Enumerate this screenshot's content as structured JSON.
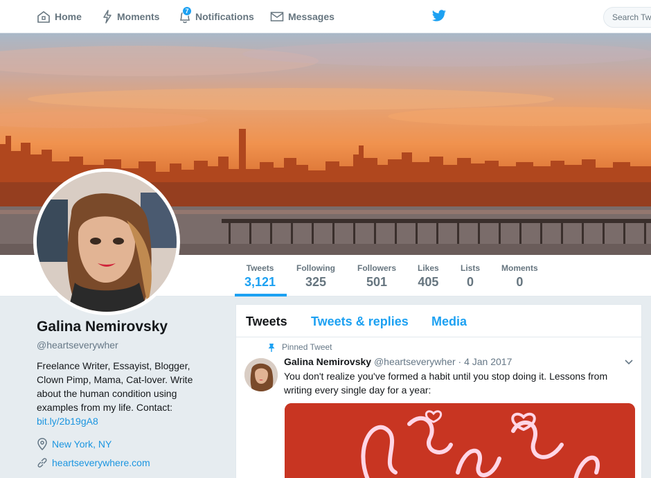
{
  "nav": {
    "home": "Home",
    "moments": "Moments",
    "notifications": "Notifications",
    "notifications_count": "7",
    "messages": "Messages",
    "search_placeholder": "Search Tw"
  },
  "stats": [
    {
      "label": "Tweets",
      "value": "3,121"
    },
    {
      "label": "Following",
      "value": "325"
    },
    {
      "label": "Followers",
      "value": "501"
    },
    {
      "label": "Likes",
      "value": "405"
    },
    {
      "label": "Lists",
      "value": "0"
    },
    {
      "label": "Moments",
      "value": "0"
    }
  ],
  "profile": {
    "name": "Galina Nemirovsky",
    "handle": "@heartseverywher",
    "bio": "Freelance Writer, Essayist, Blogger, Clown Pimp, Mama, Cat-lover. Write about the human condition using examples from my life. Contact:",
    "bio_link": "bit.ly/2b19gA8",
    "location": "New York, NY",
    "website": "heartseverywhere.com"
  },
  "tabs": [
    "Tweets",
    "Tweets & replies",
    "Media"
  ],
  "tweet": {
    "pinned_label": "Pinned Tweet",
    "name": "Galina Nemirovsky",
    "handle": "@heartseverywher",
    "date": "· 4 Jan 2017",
    "text": "You don't realize you've formed a habit until you stop doing it. Lessons from writing every single day for a year:"
  },
  "colors": {
    "accent": "#1da1f2",
    "link": "#1b95e0",
    "muted": "#657786",
    "background": "#e6ecf0"
  },
  "icons": [
    "home-icon",
    "moments-icon",
    "notifications-icon",
    "messages-icon",
    "twitter-bird-icon",
    "pin-icon",
    "location-icon",
    "link-icon",
    "chevron-down-icon"
  ]
}
